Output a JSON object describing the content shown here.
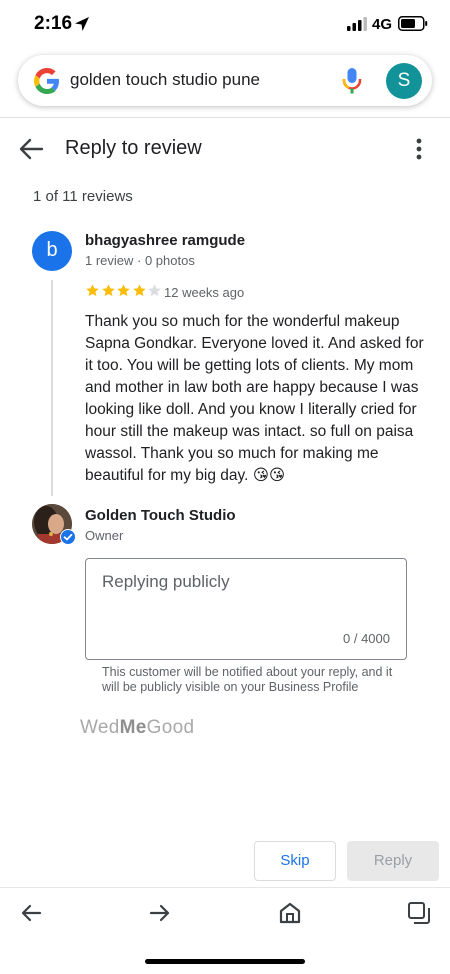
{
  "status_bar": {
    "time": "2:16",
    "network": "4G"
  },
  "search": {
    "query": "golden touch studio pune",
    "account_initial": "S"
  },
  "header": {
    "title": "Reply to review"
  },
  "review_position": "1 of 11 reviews",
  "review": {
    "avatar_initial": "b",
    "reviewer_name": "bhagyashree ramgude",
    "reviewer_meta": "1 review · 0 photos",
    "rating": 4,
    "max_rating": 5,
    "time_ago": "12 weeks ago",
    "text": "Thank you so much for the wonderful makeup Sapna Gondkar. Everyone loved it. And asked for it too. You will be getting lots of clients. My mom and mother in law both are happy because I was looking like doll. And you know I literally cried for hour still the makeup was intact. so full on paisa wassol. Thank you so much for making me beautiful for my big day. 😘😘"
  },
  "owner": {
    "name": "Golden Touch Studio",
    "role": "Owner"
  },
  "reply": {
    "placeholder": "Replying publicly",
    "char_count": "0 / 4000",
    "note": "This customer will be notified about your reply, and it will be publicly visible on your Business Profile"
  },
  "watermark": {
    "part1": "Wed",
    "part2": "Me",
    "part3": "Good"
  },
  "actions": {
    "skip_label": "Skip",
    "reply_label": "Reply"
  },
  "colors": {
    "accent": "#1a73e8",
    "star_filled": "#fbbc04",
    "star_empty": "#dadce0",
    "account_avatar": "#12939a"
  }
}
